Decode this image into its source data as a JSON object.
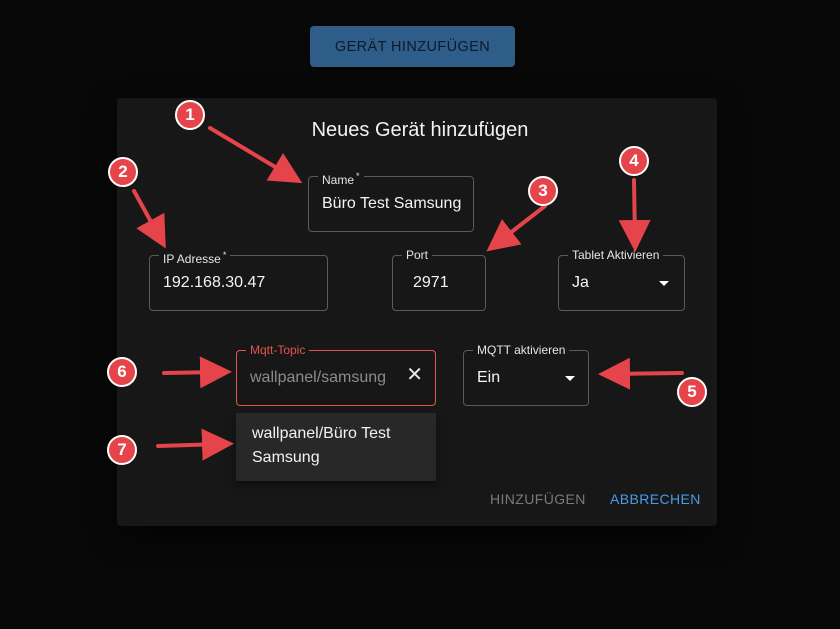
{
  "top_button": {
    "label": "GERÄT HINZUFÜGEN"
  },
  "dialog": {
    "title": "Neues Gerät hinzufügen",
    "fields": {
      "name": {
        "label": "Name",
        "required_mark": "*",
        "value": "Büro Test Samsung"
      },
      "ip": {
        "label": "IP Adresse",
        "required_mark": "*",
        "value": "192.168.30.47"
      },
      "port": {
        "label": "Port",
        "value": "2971"
      },
      "tablet": {
        "label": "Tablet Aktivieren",
        "value": "Ja"
      },
      "mqtt_topic": {
        "label": "Mqtt-Topic",
        "value": "wallpanel/samsung",
        "clear_icon": "close-icon"
      },
      "mqtt_active": {
        "label": "MQTT aktivieren",
        "value": "Ein"
      }
    },
    "autocomplete": {
      "options": [
        "wallpanel/Büro Test Samsung"
      ]
    },
    "actions": {
      "add": "HINZUFÜGEN",
      "cancel": "ABBRECHEN"
    }
  },
  "annotations": [
    "1",
    "2",
    "3",
    "4",
    "5",
    "6",
    "7"
  ],
  "colors": {
    "background": "#080808",
    "dialog": "#171717",
    "primary_button": "#2f5d8a",
    "focus": "#e2544a",
    "cancel_text": "#4a9be8",
    "disabled_text": "#7a7a7a",
    "annotation": "#e5454a"
  }
}
